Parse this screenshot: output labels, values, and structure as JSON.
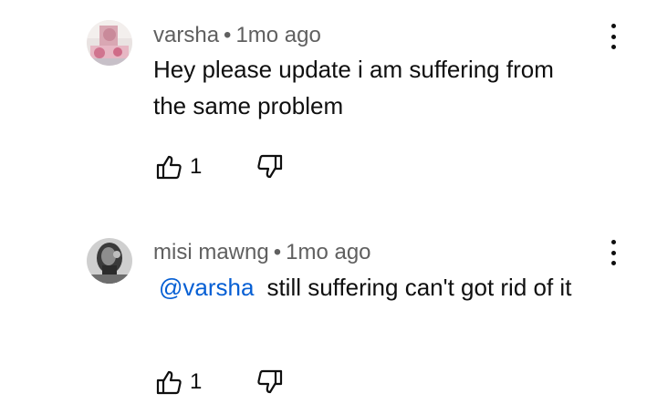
{
  "comments": [
    {
      "author": "varsha",
      "separator": "•",
      "time": "1mo ago",
      "mention": "",
      "text": "Hey please update i am suffering from the same problem",
      "likes": "1"
    },
    {
      "author": "misi mawng",
      "separator": "•",
      "time": "1mo ago",
      "mention": "@varsha",
      "text": "still suffering can't got rid of it",
      "likes": "1"
    }
  ],
  "icons": {
    "like": "thumbs-up-icon",
    "dislike": "thumbs-down-icon",
    "more": "more-vert-icon"
  },
  "colors": {
    "mention": "#065fd4",
    "meta": "#606060",
    "text": "#0f0f0f"
  }
}
